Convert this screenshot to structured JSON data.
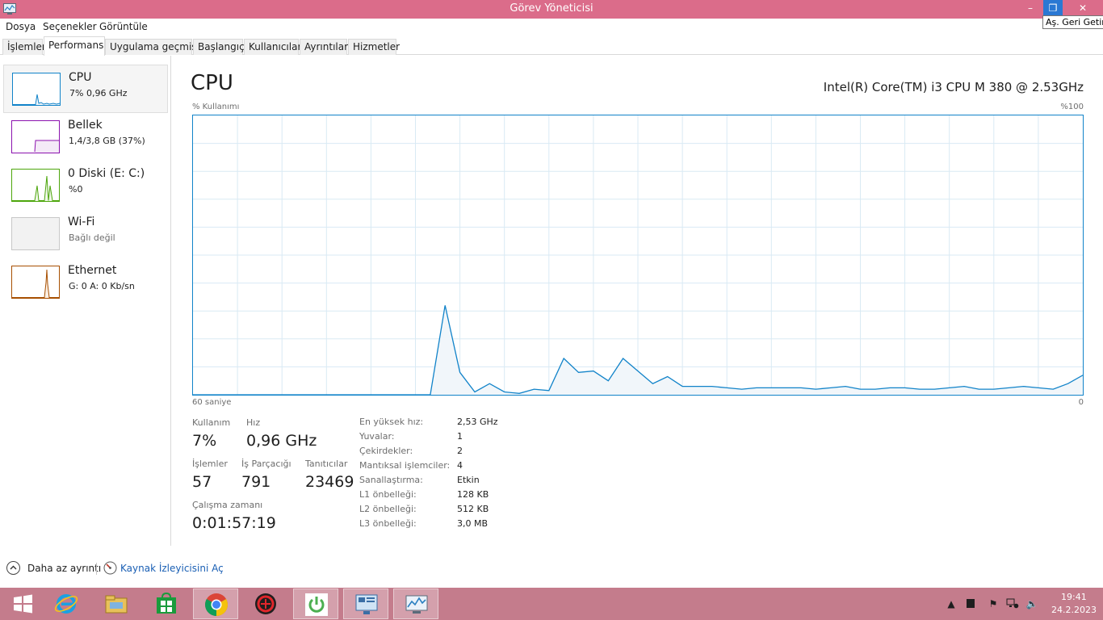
{
  "window": {
    "title": "Görev Yöneticisi",
    "minimize_glyph": "–",
    "restore_glyph": "❐",
    "close_glyph": "✕",
    "tooltip": "Aş. Geri Getir"
  },
  "menu": [
    "Dosya",
    "Seçenekler",
    "Görüntüle"
  ],
  "tabs": [
    "İşlemler",
    "Performans",
    "Uygulama geçmişi",
    "Başlangıç",
    "Kullanıcılar",
    "Ayrıntılar",
    "Hizmetler"
  ],
  "active_tab": "Performans",
  "sidebar": [
    {
      "title": "CPU",
      "subtitle": "7% 0,96 GHz",
      "color": "#1183c9",
      "selected": true
    },
    {
      "title": "Bellek",
      "subtitle": "1,4/3,8 GB (37%)",
      "color": "#8b12ae"
    },
    {
      "title": "0 Diski (E: C:)",
      "subtitle": "%0",
      "color": "#4da60c"
    },
    {
      "title": "Wi-Fi",
      "subtitle": "Bağlı değil",
      "color": "#999999"
    },
    {
      "title": "Ethernet",
      "subtitle": "G: 0 A: 0 Kb/sn",
      "color": "#a74f01"
    }
  ],
  "main": {
    "title": "CPU",
    "cpu_model": "Intel(R) Core(TM) i3 CPU M 380 @ 2.53GHz",
    "y_label": "% Kullanımı",
    "y_max_label": "%100",
    "x_left_label": "60 saniye",
    "x_right_label": "0"
  },
  "chart_data": {
    "type": "area",
    "title": "",
    "xlabel": "60 saniye",
    "ylabel": "% Kullanımı",
    "xlim": [
      60,
      0
    ],
    "ylim": [
      0,
      100
    ],
    "grid": true,
    "x": [
      60,
      44,
      43,
      42,
      41,
      40,
      39,
      38,
      37,
      36,
      35,
      34,
      33,
      32,
      31,
      30,
      29,
      28,
      27,
      26,
      25,
      24,
      23,
      22,
      21,
      20,
      19,
      18,
      17,
      16,
      15,
      14,
      13,
      12,
      11,
      10,
      9,
      8,
      7,
      6,
      5,
      4,
      3,
      2,
      1,
      0
    ],
    "y": [
      0,
      0,
      32,
      8,
      1,
      4,
      1,
      0.5,
      2,
      1.5,
      13,
      8,
      8.5,
      5,
      13,
      8.5,
      4,
      6.5,
      3,
      3,
      3,
      2.5,
      2,
      2.5,
      2.5,
      2.5,
      2.5,
      2,
      2.5,
      3,
      2,
      2,
      2.5,
      2.5,
      2,
      2,
      2.5,
      3,
      2,
      2,
      2.5,
      3,
      2.5,
      2,
      4,
      7
    ],
    "line_color": "#1183c9",
    "fill_color": "#f1f6fa"
  },
  "stats": {
    "usage_label": "Kullanım",
    "usage_value": "7%",
    "speed_label": "Hız",
    "speed_value": "0,96 GHz",
    "processes_label": "İşlemler",
    "processes_value": "57",
    "threads_label": "İş Parçacığı",
    "threads_value": "791",
    "handles_label": "Tanıtıcılar",
    "handles_value": "23469",
    "uptime_label": "Çalışma zamanı",
    "uptime_value": "0:01:57:19"
  },
  "specs": [
    {
      "label": "En yüksek hız:",
      "value": "2,53 GHz"
    },
    {
      "label": "Yuvalar:",
      "value": "1"
    },
    {
      "label": "Çekirdekler:",
      "value": "2"
    },
    {
      "label": "Mantıksal işlemciler:",
      "value": "4"
    },
    {
      "label": "Sanallaştırma:",
      "value": "Etkin"
    },
    {
      "label": "L1 önbelleği:",
      "value": "128 KB"
    },
    {
      "label": "L2 önbelleği:",
      "value": "512 KB"
    },
    {
      "label": "L3 önbelleği:",
      "value": "3,0 MB"
    }
  ],
  "footer": {
    "fewer_details": "Daha az ayrıntı",
    "open_resmon": "Kaynak İzleyicisini Aç"
  },
  "taskbar": {
    "apps": [
      "start-icon",
      "internet-explorer-icon",
      "file-explorer-icon",
      "store-icon",
      "chrome-icon",
      "red-app-icon",
      "power-app-icon",
      "control-panel-icon",
      "task-manager-icon"
    ],
    "active_app": "task-manager-icon",
    "tray_glyphs": {
      "chevron": "▲",
      "flag": "⚑",
      "speaker": "🔈"
    },
    "time": "19:41",
    "date": "24.2.2023"
  }
}
